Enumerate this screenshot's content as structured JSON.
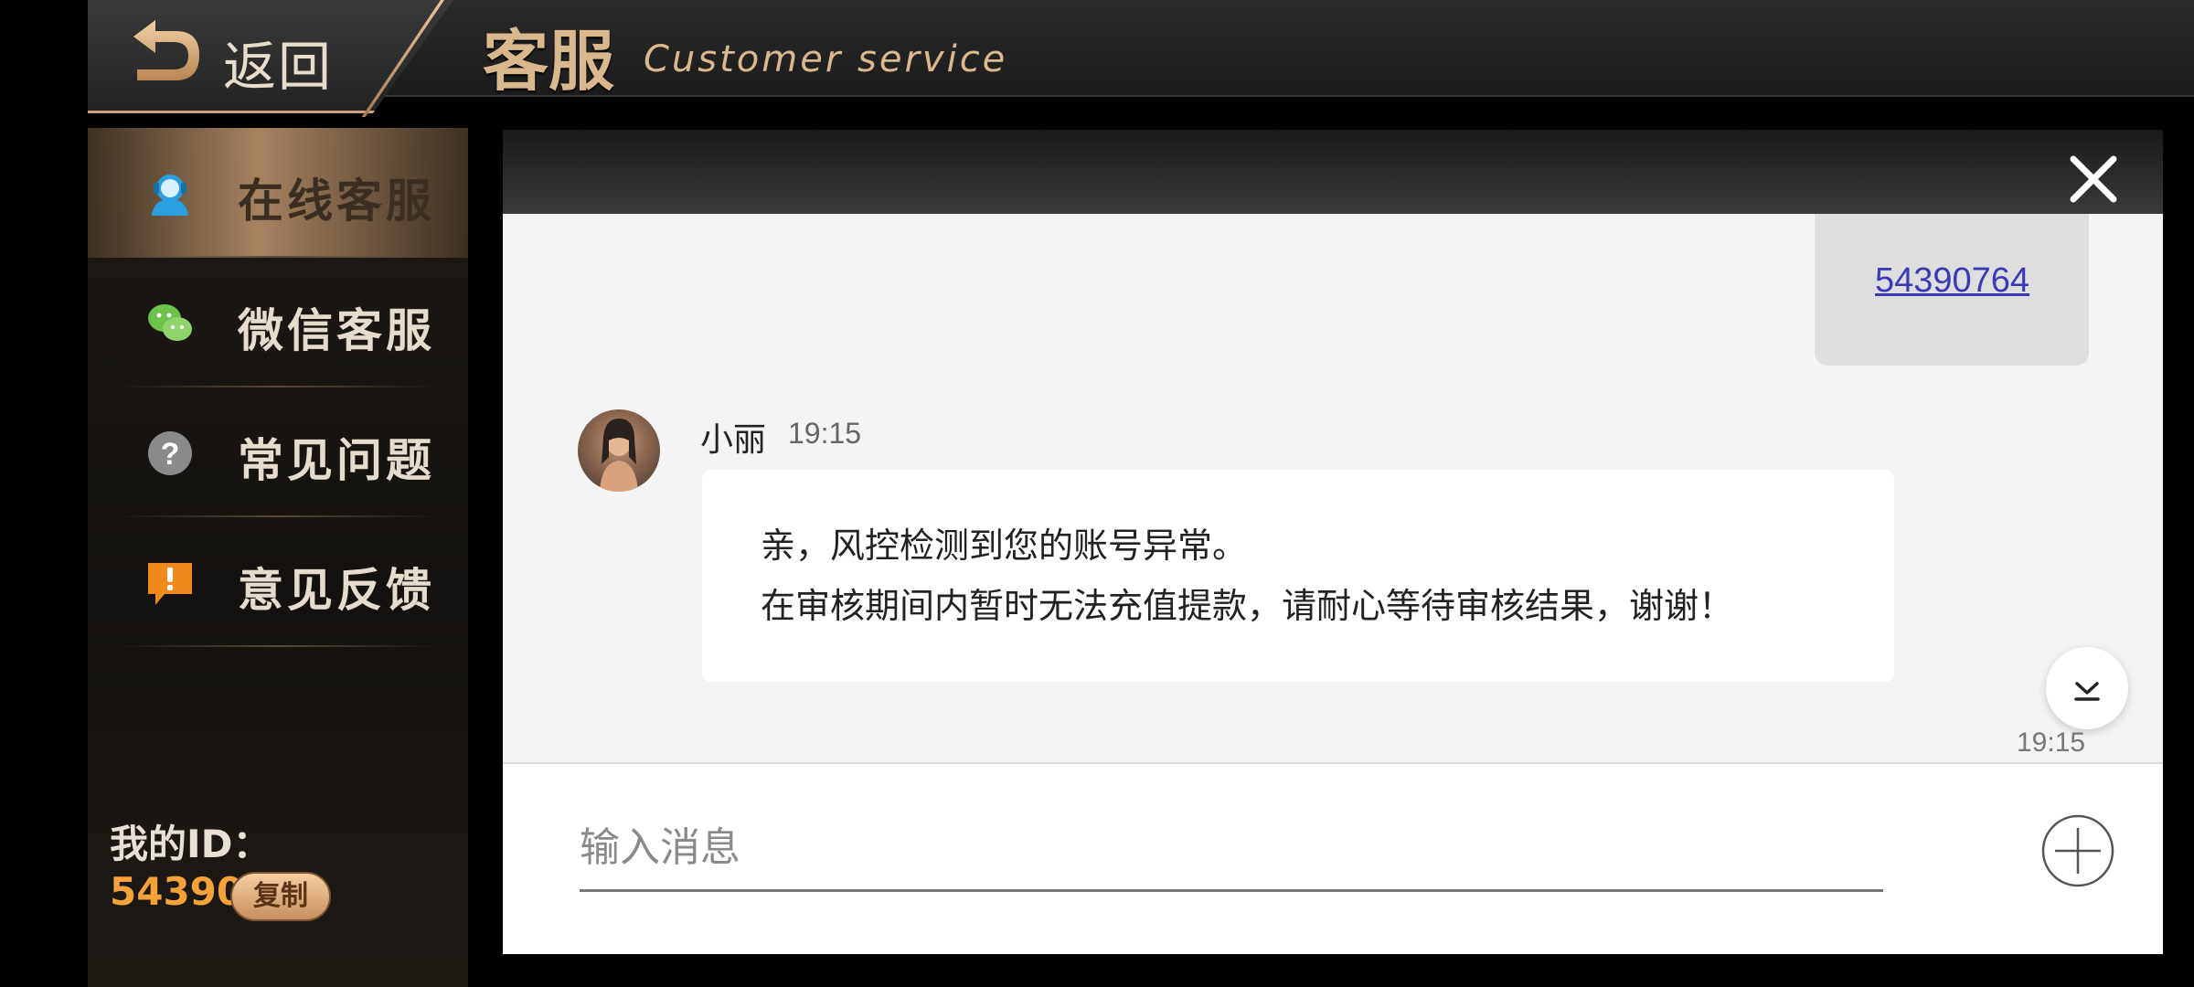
{
  "header": {
    "back_label": "返回",
    "title_cn": "客服",
    "title_en": "Customer service"
  },
  "sidebar": {
    "items": [
      {
        "label": "在线客服",
        "icon": "agent-icon",
        "active": true
      },
      {
        "label": "微信客服",
        "icon": "wechat-icon",
        "active": false
      },
      {
        "label": "常见问题",
        "icon": "question-icon",
        "active": false
      },
      {
        "label": "意见反馈",
        "icon": "feedback-icon",
        "active": false
      }
    ],
    "my_id_label": "我的ID：",
    "my_id_value": "54390764",
    "copy_label": "复制"
  },
  "chat": {
    "sent_message": "54390764",
    "sender_name": "小丽",
    "sender_time": "19:15",
    "received_lines": [
      "亲，风控检测到您的账号异常。",
      "在审核期间内暂时无法充值提款，请耐心等待审核结果，谢谢！"
    ],
    "bottom_time": "19:15",
    "input_placeholder": "输入消息"
  },
  "colors": {
    "accent_gold": "#d9b88e",
    "id_orange": "#f5a23a",
    "link_blue": "#3a3ab8"
  }
}
